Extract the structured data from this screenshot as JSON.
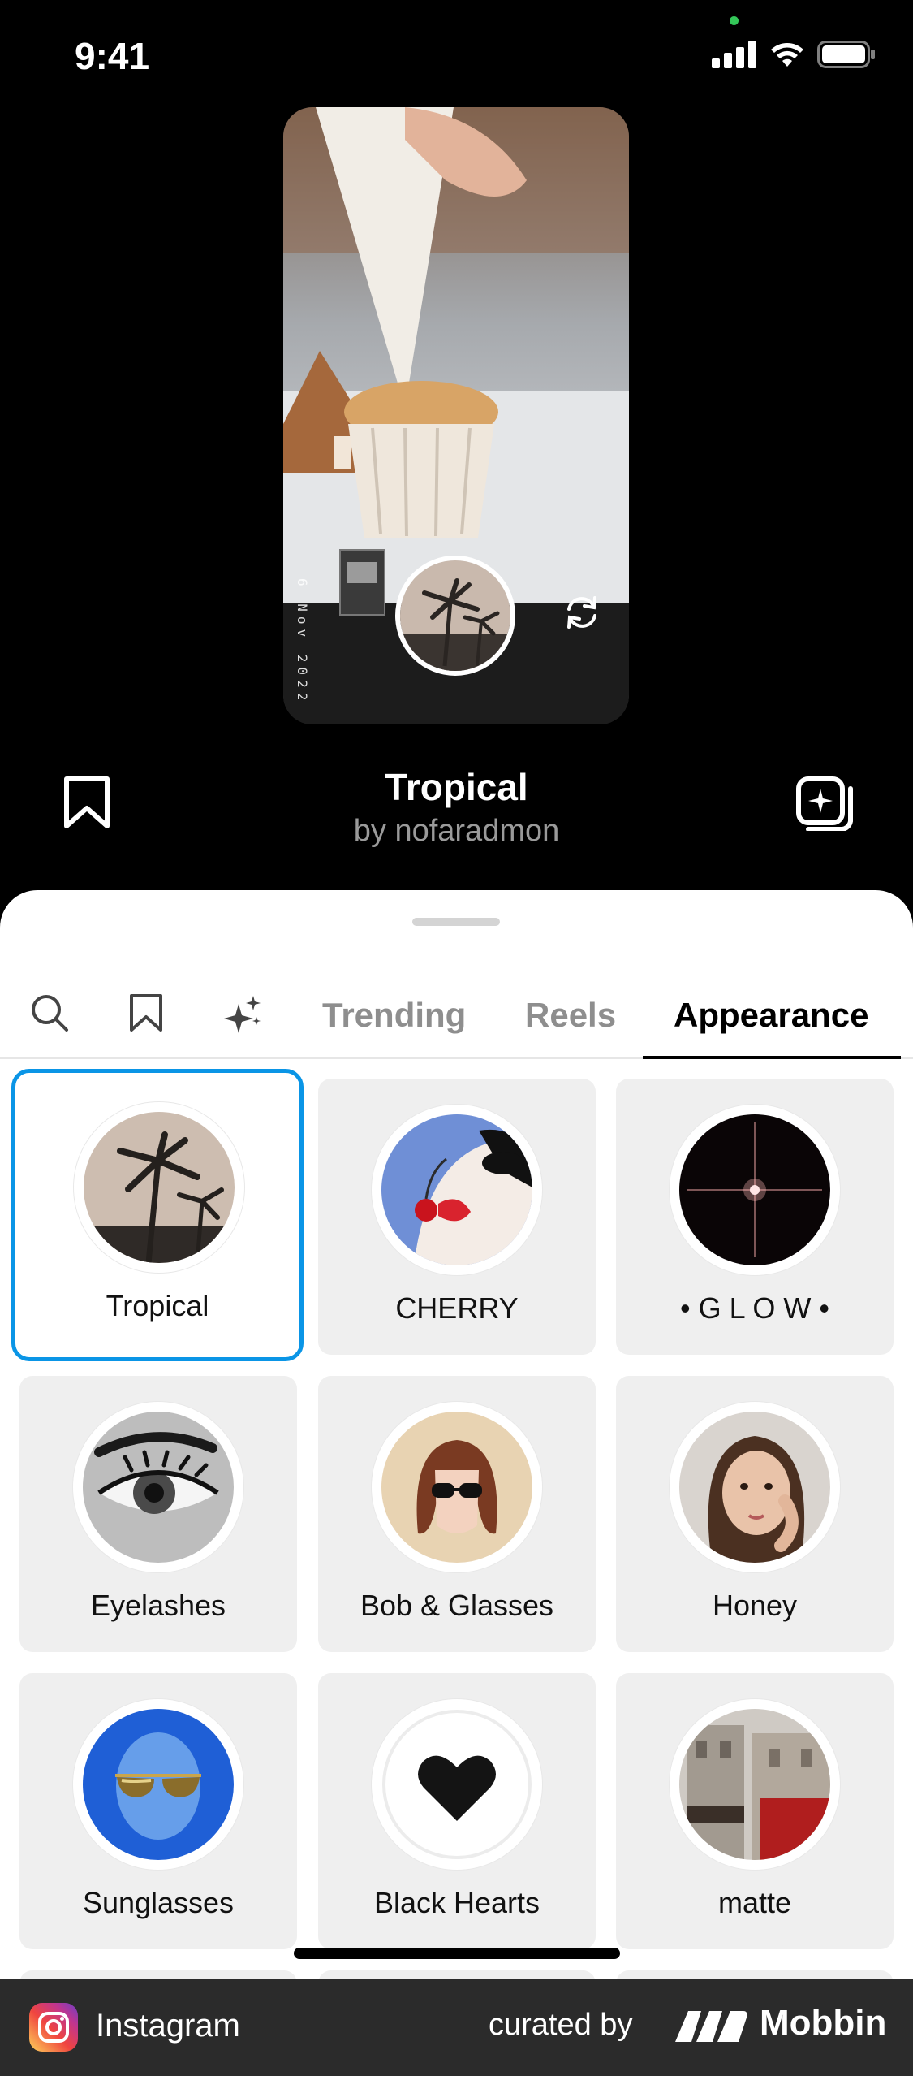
{
  "status_bar": {
    "time": "9:41"
  },
  "effect": {
    "name": "Tropical",
    "author": "by nofaradmon",
    "date_stamp": "6 Nov 2022"
  },
  "tabs": [
    {
      "kind": "icon",
      "icon": "search-icon"
    },
    {
      "kind": "icon",
      "icon": "bookmark-icon"
    },
    {
      "kind": "icon",
      "icon": "sparkles-icon"
    },
    {
      "kind": "label",
      "label": "Trending"
    },
    {
      "kind": "label",
      "label": "Reels"
    },
    {
      "kind": "label",
      "label": "Appearance",
      "active": true
    }
  ],
  "effects_grid": [
    {
      "label": "Tropical",
      "selected": true
    },
    {
      "label": "CHERRY"
    },
    {
      "label": "• G L O W •"
    },
    {
      "label": "Eyelashes"
    },
    {
      "label": "Bob & Glasses"
    },
    {
      "label": "Honey"
    },
    {
      "label": "Sunglasses"
    },
    {
      "label": "Black Hearts"
    },
    {
      "label": "matte"
    }
  ],
  "footer": {
    "app_name": "Instagram",
    "curated_by": "curated by",
    "brand": "Mobbin"
  },
  "colors": {
    "selected_border": "#0a95e6",
    "card_bg": "#efefef",
    "footer_bg": "#2b2b2b"
  }
}
